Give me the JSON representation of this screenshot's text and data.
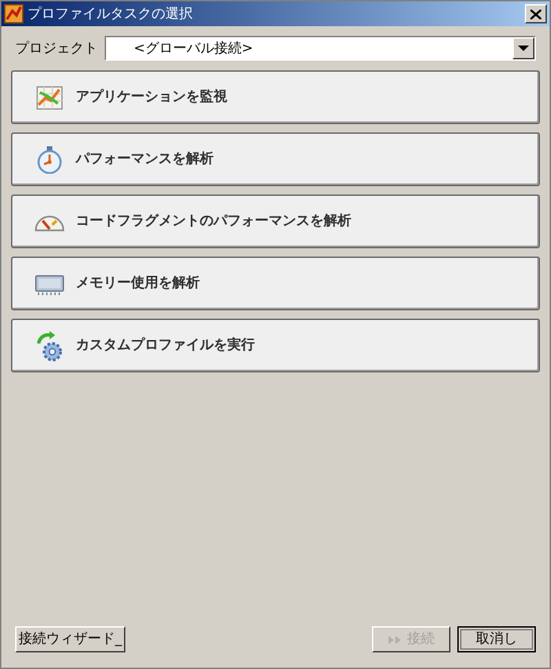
{
  "window": {
    "title": "プロファイルタスクの選択"
  },
  "project": {
    "label": "プロジェクト",
    "value": "<グローバル接続>"
  },
  "tasks": [
    {
      "kind": "monitor",
      "label": "アプリケーションを監視"
    },
    {
      "kind": "stopwatch",
      "label": "パフォーマンスを解析"
    },
    {
      "kind": "gauge",
      "label": "コードフラグメントのパフォーマンスを解析"
    },
    {
      "kind": "memory",
      "label": "メモリー使用を解析"
    },
    {
      "kind": "custom",
      "label": "カスタムプロファイルを実行"
    }
  ],
  "buttons": [
    {
      "label": "接続ウィザード_",
      "disabled": false,
      "default": false
    },
    {
      "label": "接続",
      "disabled": true,
      "default": false,
      "kind": "connect"
    },
    {
      "label": "取消し",
      "disabled": false,
      "default": true
    }
  ]
}
